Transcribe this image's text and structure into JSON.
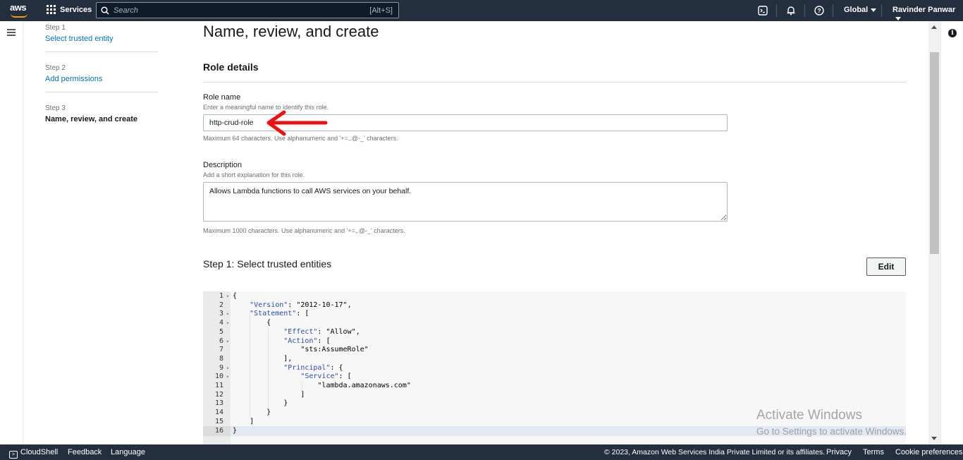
{
  "topnav": {
    "logo_text": "aws",
    "services_label": "Services",
    "search_placeholder": "Search",
    "search_shortcut": "[Alt+S]",
    "region": "Global",
    "user": "Ravinder Panwar"
  },
  "steps": [
    {
      "num": "Step 1",
      "label": "Select trusted entity"
    },
    {
      "num": "Step 2",
      "label": "Add permissions"
    },
    {
      "num": "Step 3",
      "label": "Name, review, and create"
    }
  ],
  "main": {
    "title": "Name, review, and create",
    "section_title": "Role details",
    "role_name_label": "Role name",
    "role_name_hint": "Enter a meaningful name to identify this role.",
    "role_name_value": "http-crud-role",
    "role_name_constraint": "Maximum 64 characters. Use alphanumeric and '+=,.@-_' characters.",
    "description_label": "Description",
    "description_hint": "Add a short explanation for this role.",
    "description_value": "Allows Lambda functions to call AWS services on your behalf.",
    "description_constraint": "Maximum 1000 characters. Use alphanumeric and '+=,.@-_' characters.",
    "step1_title": "Step 1: Select trusted entities",
    "edit_label": "Edit"
  },
  "editor": {
    "lines": [
      "{",
      "    \"Version\": \"2012-10-17\",",
      "    \"Statement\": [",
      "        {",
      "            \"Effect\": \"Allow\",",
      "            \"Action\": [",
      "                \"sts:AssumeRole\"",
      "            ],",
      "            \"Principal\": {",
      "                \"Service\": [",
      "                    \"lambda.amazonaws.com\"",
      "                ]",
      "            }",
      "        }",
      "    ]",
      "}"
    ],
    "line_numbers": [
      "1",
      "2",
      "3",
      "4",
      "5",
      "6",
      "7",
      "8",
      "9",
      "10",
      "11",
      "12",
      "13",
      "14",
      "15",
      "16"
    ],
    "foldable": [
      1,
      3,
      4,
      6,
      9,
      10
    ]
  },
  "watermark": {
    "line1": "Activate Windows",
    "line2": "Go to Settings to activate Windows."
  },
  "footer": {
    "cloudshell": "CloudShell",
    "feedback": "Feedback",
    "language": "Language",
    "copyright": "© 2023, Amazon Web Services India Private Limited or its affiliates.",
    "privacy": "Privacy",
    "terms": "Terms",
    "cookies": "Cookie preferences"
  }
}
